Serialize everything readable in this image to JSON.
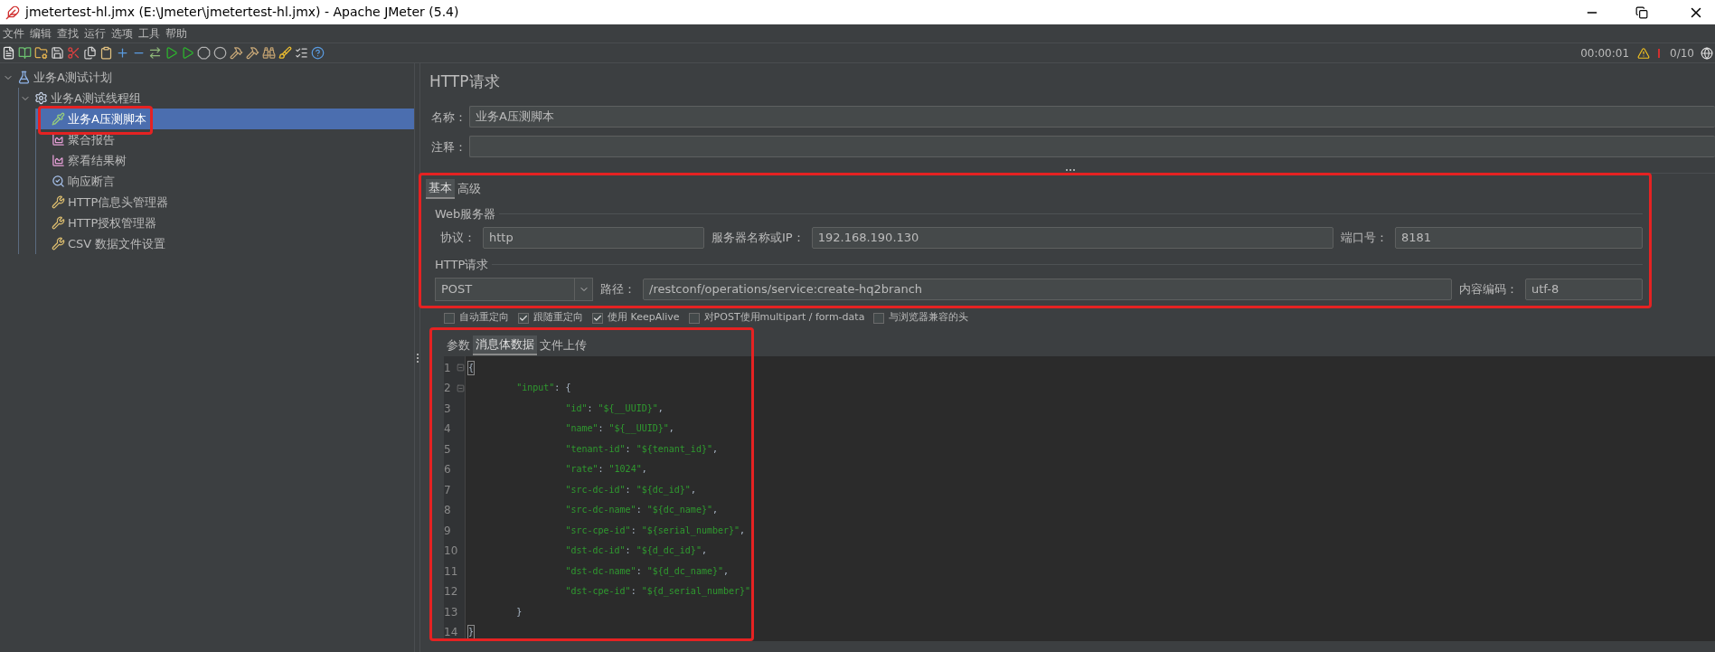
{
  "window": {
    "title": "jmetertest-hl.jmx (E:\\Jmeter\\jmetertest-hl.jmx) - Apache JMeter (5.4)"
  },
  "menu": [
    "文件",
    "编辑",
    "查找",
    "运行",
    "选项",
    "工具",
    "帮助"
  ],
  "status": {
    "timer": "00:00:01",
    "threads": "0/10"
  },
  "tree": [
    {
      "label": "业务A测试计划",
      "kind": "plan",
      "expanded": true,
      "selected": false,
      "children": [
        {
          "label": "业务A测试线程组",
          "kind": "thread-group",
          "expanded": true,
          "selected": false,
          "children": [
            {
              "label": "业务A压测脚本",
              "kind": "sampler",
              "selected": true
            },
            {
              "label": "聚合报告",
              "kind": "listener",
              "selected": false
            },
            {
              "label": "察看结果树",
              "kind": "listener",
              "selected": false
            },
            {
              "label": "响应断言",
              "kind": "assertion",
              "selected": false
            },
            {
              "label": "HTTP信息头管理器",
              "kind": "config",
              "selected": false
            },
            {
              "label": "HTTP授权管理器",
              "kind": "config",
              "selected": false
            },
            {
              "label": "CSV 数据文件设置",
              "kind": "config",
              "selected": false
            }
          ]
        }
      ]
    }
  ],
  "panel": {
    "title": "HTTP请求",
    "name": {
      "label": "名称：",
      "value": "业务A压测脚本"
    },
    "comment": {
      "label": "注释："
    },
    "tabs": [
      {
        "label": "基本",
        "selected": true
      },
      {
        "label": "高级",
        "selected": false
      }
    ],
    "web_server": {
      "legend": "Web服务器",
      "protocol": {
        "label": "协议：",
        "value": "http"
      },
      "server": {
        "label": "服务器名称或IP：",
        "value": "192.168.190.130"
      },
      "port": {
        "label": "端口号：",
        "value": "8181"
      }
    },
    "http_request": {
      "legend": "HTTP请求",
      "method": "POST",
      "path": {
        "label": "路径：",
        "value": "/restconf/operations/service:create-hq2branch"
      },
      "encoding": {
        "label": "内容编码：",
        "value": "utf-8"
      }
    },
    "options": [
      {
        "label": "自动重定向",
        "checked": false
      },
      {
        "label": "跟随重定向",
        "checked": true
      },
      {
        "label": "使用 KeepAlive",
        "checked": true
      },
      {
        "label": "对POST使用multipart / form-data",
        "checked": false
      },
      {
        "label": "与浏览器兼容的头",
        "checked": false
      }
    ],
    "body_tabs": [
      {
        "label": "参数",
        "selected": false
      },
      {
        "label": "消息体数据",
        "selected": true
      },
      {
        "label": "文件上传",
        "selected": false
      }
    ],
    "code": [
      {
        "number": "1",
        "text": "{",
        "fold": true,
        "matched": true
      },
      {
        "number": "2",
        "text": "\t\"input\": {",
        "fold": true,
        "matched": false
      },
      {
        "number": "3",
        "text": "\t\t\"id\": \"${__UUID}\",",
        "fold": false,
        "matched": false
      },
      {
        "number": "4",
        "text": "\t\t\"name\": \"${__UUID}\",",
        "fold": false,
        "matched": false
      },
      {
        "number": "5",
        "text": "\t\t\"tenant-id\": \"${tenant_id}\",",
        "fold": false,
        "matched": false
      },
      {
        "number": "6",
        "text": "\t\t\"rate\": \"1024\",",
        "fold": false,
        "matched": false
      },
      {
        "number": "7",
        "text": "\t\t\"src-dc-id\": \"${dc_id}\",",
        "fold": false,
        "matched": false
      },
      {
        "number": "8",
        "text": "\t\t\"src-dc-name\": \"${dc_name}\",",
        "fold": false,
        "matched": false
      },
      {
        "number": "9",
        "text": "\t\t\"src-cpe-id\": \"${serial_number}\",",
        "fold": false,
        "matched": false
      },
      {
        "number": "10",
        "text": "\t\t\"dst-dc-id\": \"${d_dc_id}\",",
        "fold": false,
        "matched": false
      },
      {
        "number": "11",
        "text": "\t\t\"dst-dc-name\": \"${d_dc_name}\",",
        "fold": false,
        "matched": false
      },
      {
        "number": "12",
        "text": "\t\t\"dst-cpe-id\": \"${d_serial_number}\"",
        "fold": false,
        "matched": false
      },
      {
        "number": "13",
        "text": "\t}",
        "fold": false,
        "matched": false
      },
      {
        "number": "14",
        "text": "}",
        "fold": false,
        "matched": true
      }
    ]
  }
}
